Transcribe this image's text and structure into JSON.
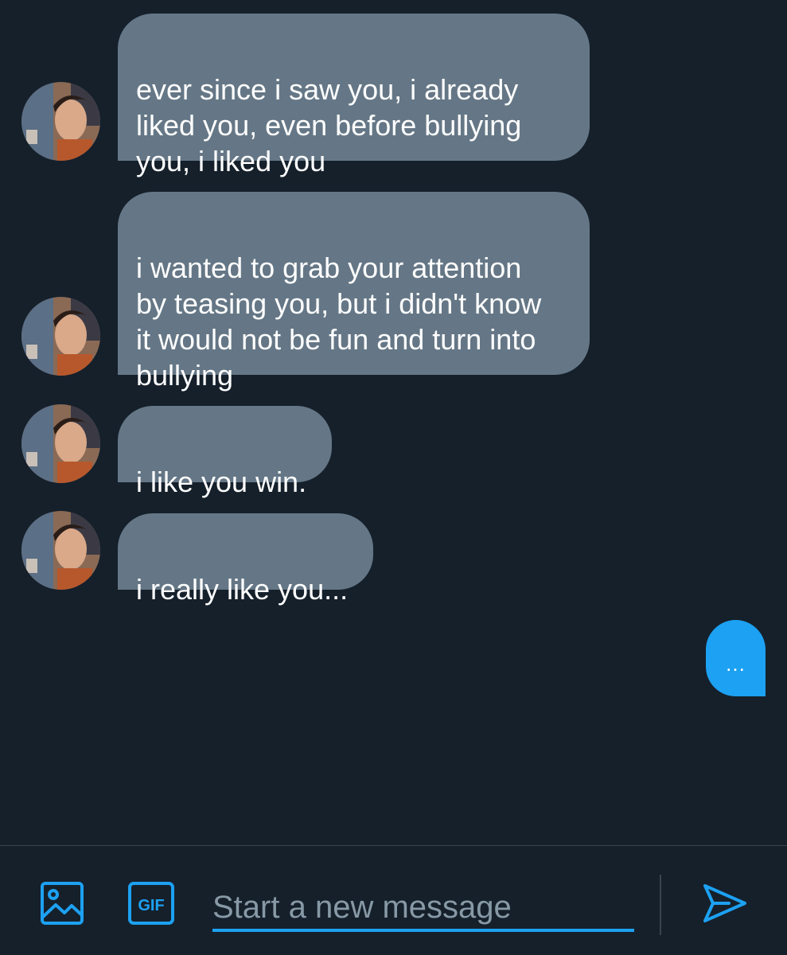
{
  "conversation": {
    "messages": [
      {
        "sender": "other",
        "text": "ever since i saw you, i already\nliked you, even before bullying\nyou, i liked you"
      },
      {
        "sender": "other",
        "text": "i wanted to grab your attention\nby teasing you, but i didn't know\nit would not be fun and turn into\nbullying"
      },
      {
        "sender": "other",
        "text": "i like you win."
      },
      {
        "sender": "other",
        "text": "i really like you..."
      }
    ],
    "typing_indicator": "..."
  },
  "composer": {
    "placeholder": "Start a new message",
    "image_icon": "image-icon",
    "gif_icon": "gif-icon",
    "gif_label": "GIF",
    "send_icon": "send-icon"
  },
  "colors": {
    "background": "#15202b",
    "incoming_bubble": "#657786",
    "accent": "#1da1f2",
    "divider": "#38444d",
    "placeholder": "#8899a6"
  }
}
